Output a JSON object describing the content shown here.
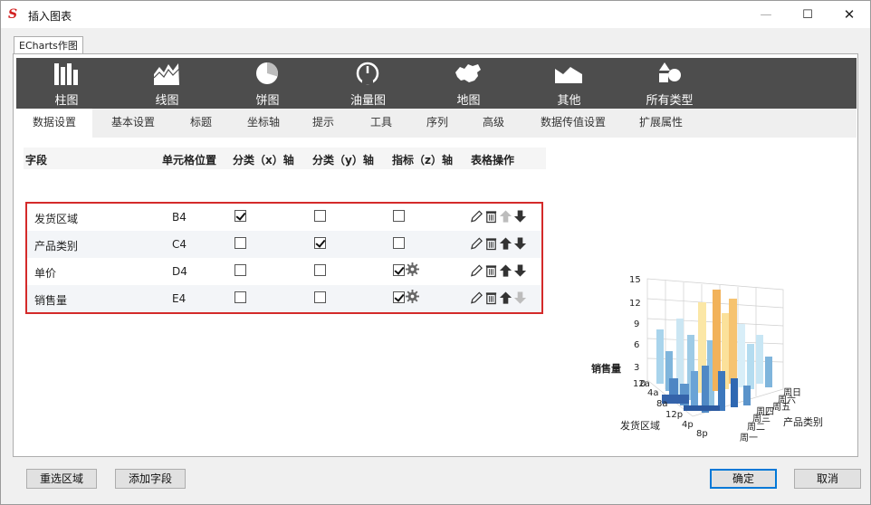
{
  "window": {
    "title": "插入图表",
    "minimize": "—",
    "maximize": "☐",
    "close": "✕",
    "logo": "S"
  },
  "outer_tab": "ECharts作图",
  "chart_types": [
    {
      "label": "柱图",
      "icon": "bar-chart-icon"
    },
    {
      "label": "线图",
      "icon": "line-chart-icon"
    },
    {
      "label": "饼图",
      "icon": "pie-chart-icon"
    },
    {
      "label": "油量图",
      "icon": "gauge-icon"
    },
    {
      "label": "地图",
      "icon": "map-icon"
    },
    {
      "label": "其他",
      "icon": "other-chart-icon"
    },
    {
      "label": "所有类型",
      "icon": "shapes-icon"
    }
  ],
  "sub_tabs": [
    "数据设置",
    "基本设置",
    "标题",
    "坐标轴",
    "提示",
    "工具",
    "序列",
    "高级",
    "数据传值设置",
    "扩展属性"
  ],
  "grid": {
    "headers": [
      "字段",
      "单元格位置",
      "分类（x）轴",
      "分类（y）轴",
      "指标（z）轴",
      "表格操作"
    ],
    "rows": [
      {
        "field": "发货区域",
        "cell": "B4",
        "x": true,
        "y": false,
        "z": false,
        "gear": false,
        "up_enabled": false,
        "down_enabled": true
      },
      {
        "field": "产品类别",
        "cell": "C4",
        "x": false,
        "y": true,
        "z": false,
        "gear": false,
        "up_enabled": true,
        "down_enabled": true
      },
      {
        "field": "单价",
        "cell": "D4",
        "x": false,
        "y": false,
        "z": true,
        "gear": true,
        "up_enabled": true,
        "down_enabled": true
      },
      {
        "field": "销售量",
        "cell": "E4",
        "x": false,
        "y": false,
        "z": true,
        "gear": true,
        "up_enabled": true,
        "down_enabled": false
      }
    ]
  },
  "preview": {
    "z_label": "销售量",
    "x_label": "发货区域",
    "y_label": "产品类别",
    "z_ticks": [
      "15",
      "12",
      "9",
      "6",
      "3",
      "0"
    ],
    "x_ticks": [
      "12a",
      "4a",
      "8a",
      "12p",
      "4p",
      "8p"
    ],
    "y_ticks": [
      "周一",
      "周二",
      "周三",
      "周四",
      "周五",
      "周六",
      "周日"
    ]
  },
  "buttons": {
    "reselect": "重选区域",
    "add_field": "添加字段",
    "ok": "确定",
    "cancel": "取消"
  }
}
